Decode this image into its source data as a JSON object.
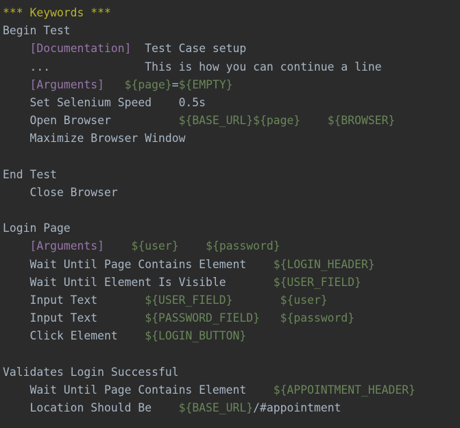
{
  "theme": {
    "background": "#2b2b2b",
    "plain": "#a9b7c6",
    "header": "#bbb529",
    "setting": "#9876aa",
    "variable": "#6a8759"
  },
  "lines": [
    [
      {
        "t": "header",
        "v": "*** Keywords ***"
      }
    ],
    [
      {
        "t": "plain",
        "v": "Begin Test"
      }
    ],
    [
      {
        "t": "plain",
        "v": "    "
      },
      {
        "t": "setting",
        "v": "[Documentation]"
      },
      {
        "t": "plain",
        "v": "  Test Case setup"
      }
    ],
    [
      {
        "t": "plain",
        "v": "    ...              This is how you can continue a line"
      }
    ],
    [
      {
        "t": "plain",
        "v": "    "
      },
      {
        "t": "setting",
        "v": "[Arguments]"
      },
      {
        "t": "plain",
        "v": "   "
      },
      {
        "t": "var",
        "v": "${page}"
      },
      {
        "t": "plain",
        "v": "="
      },
      {
        "t": "var",
        "v": "${EMPTY}"
      }
    ],
    [
      {
        "t": "plain",
        "v": "    Set Selenium Speed    0.5s"
      }
    ],
    [
      {
        "t": "plain",
        "v": "    Open Browser          "
      },
      {
        "t": "var",
        "v": "${BASE_URL}${page}"
      },
      {
        "t": "plain",
        "v": "    "
      },
      {
        "t": "var",
        "v": "${BROWSER}"
      }
    ],
    [
      {
        "t": "plain",
        "v": "    Maximize Browser Window"
      }
    ],
    [],
    [
      {
        "t": "plain",
        "v": "End Test"
      }
    ],
    [
      {
        "t": "plain",
        "v": "    Close Browser"
      }
    ],
    [],
    [
      {
        "t": "plain",
        "v": "Login Page"
      }
    ],
    [
      {
        "t": "plain",
        "v": "    "
      },
      {
        "t": "setting",
        "v": "[Arguments]"
      },
      {
        "t": "plain",
        "v": "    "
      },
      {
        "t": "var",
        "v": "${user}"
      },
      {
        "t": "plain",
        "v": "    "
      },
      {
        "t": "var",
        "v": "${password}"
      }
    ],
    [
      {
        "t": "plain",
        "v": "    Wait Until Page Contains Element    "
      },
      {
        "t": "var",
        "v": "${LOGIN_HEADER}"
      }
    ],
    [
      {
        "t": "plain",
        "v": "    Wait Until Element Is Visible       "
      },
      {
        "t": "var",
        "v": "${USER_FIELD}"
      }
    ],
    [
      {
        "t": "plain",
        "v": "    Input Text       "
      },
      {
        "t": "var",
        "v": "${USER_FIELD}"
      },
      {
        "t": "plain",
        "v": "       "
      },
      {
        "t": "var",
        "v": "${user}"
      }
    ],
    [
      {
        "t": "plain",
        "v": "    Input Text       "
      },
      {
        "t": "var",
        "v": "${PASSWORD_FIELD}"
      },
      {
        "t": "plain",
        "v": "   "
      },
      {
        "t": "var",
        "v": "${password}"
      }
    ],
    [
      {
        "t": "plain",
        "v": "    Click Element    "
      },
      {
        "t": "var",
        "v": "${LOGIN_BUTTON}"
      }
    ],
    [],
    [
      {
        "t": "plain",
        "v": "Validates Login Successful"
      }
    ],
    [
      {
        "t": "plain",
        "v": "    Wait Until Page Contains Element    "
      },
      {
        "t": "var",
        "v": "${APPOINTMENT_HEADER}"
      }
    ],
    [
      {
        "t": "plain",
        "v": "    Location Should Be    "
      },
      {
        "t": "var",
        "v": "${BASE_URL}"
      },
      {
        "t": "plain",
        "v": "/#appointment"
      }
    ]
  ]
}
